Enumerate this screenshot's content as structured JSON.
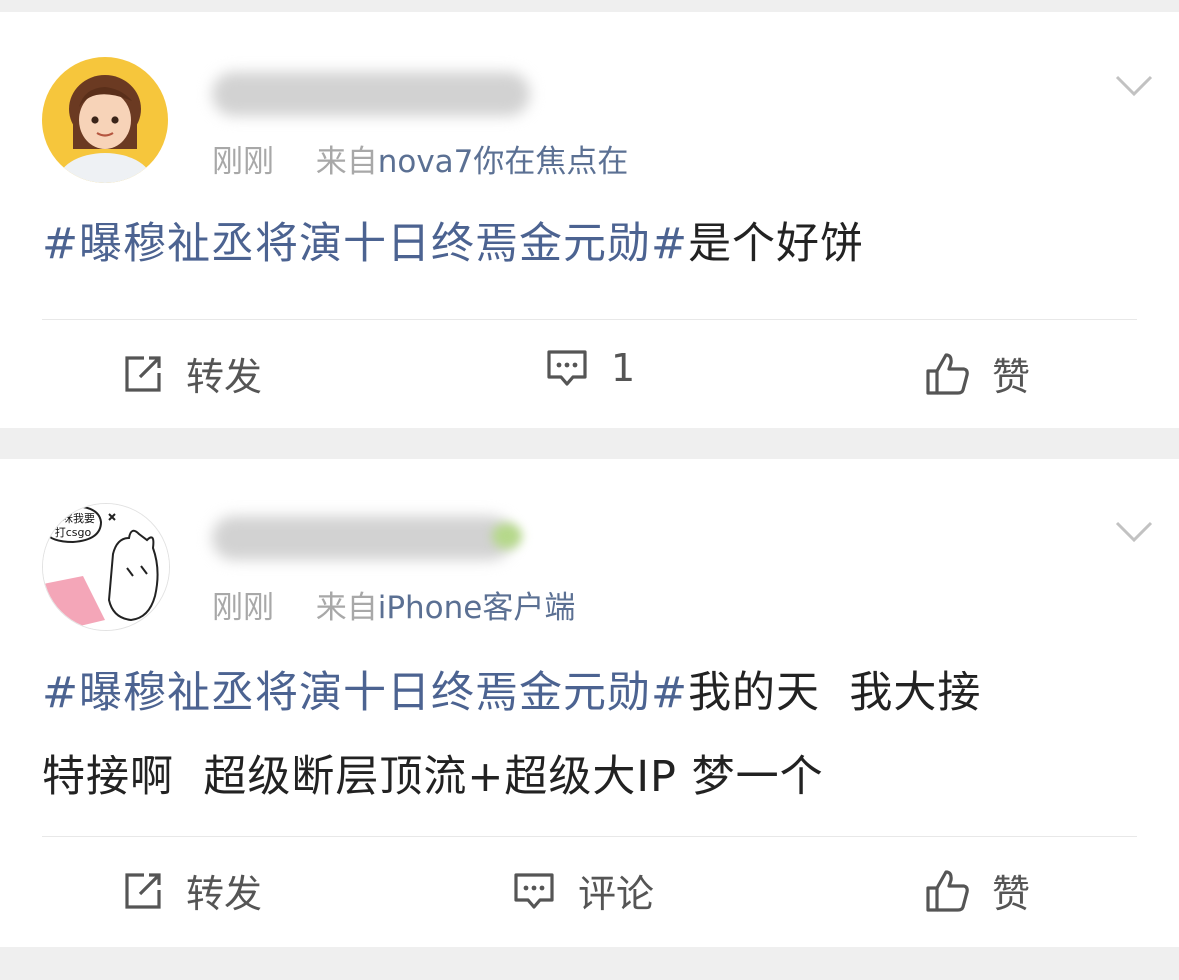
{
  "posts": [
    {
      "time": "刚刚",
      "from_prefix": "来自",
      "source": "nova7你在焦点在",
      "hashtag": "#曝穆祉丞将演十日终焉金元勋#",
      "text": "是个好饼",
      "actions": {
        "repost": "转发",
        "comment": "1",
        "like": "赞"
      }
    },
    {
      "time": "刚刚",
      "from_prefix": "来自",
      "source": "iPhone客户端",
      "hashtag": "#曝穆祉丞将演十日终焉金元勋#",
      "text_line1": "我的天  我大接",
      "text_line2": "特接啊  超级断层顶流+超级大IP 梦一个",
      "avatar_caption": [
        "妈咪我要",
        "打csgo"
      ],
      "actions": {
        "repost": "转发",
        "comment": "评论",
        "like": "赞"
      }
    }
  ],
  "colors": {
    "hashtag": "#4c6391",
    "source": "#5b7093",
    "muted": "#a8a8a8",
    "background": "#efefef"
  },
  "icons": [
    "chevron-down-icon",
    "repost-icon",
    "comment-icon",
    "like-icon"
  ]
}
